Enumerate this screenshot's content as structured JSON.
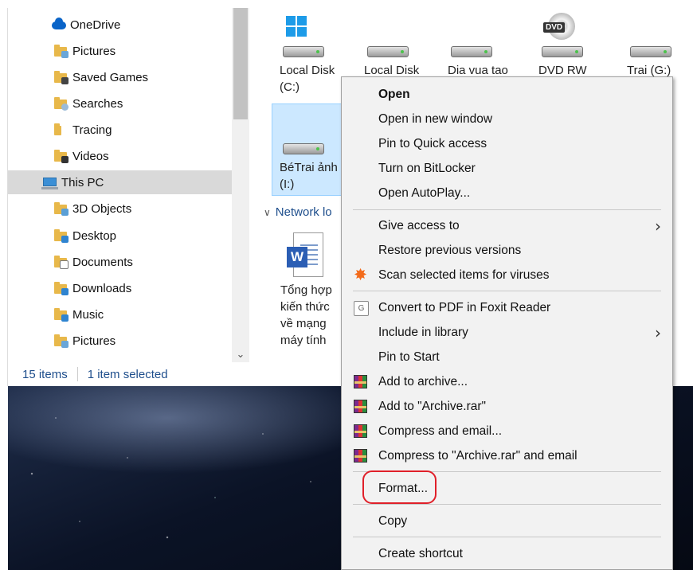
{
  "nav": {
    "items": [
      {
        "label": "OneDrive",
        "icon": "onedrive-icon"
      },
      {
        "label": "Pictures",
        "icon": "pictures-folder-icon"
      },
      {
        "label": "Saved Games",
        "icon": "saved-games-folder-icon"
      },
      {
        "label": "Searches",
        "icon": "searches-folder-icon"
      },
      {
        "label": "Tracing",
        "icon": "folder-icon"
      },
      {
        "label": "Videos",
        "icon": "videos-folder-icon"
      },
      {
        "label": "This PC",
        "icon": "this-pc-icon"
      },
      {
        "label": "3D Objects",
        "icon": "3d-objects-folder-icon"
      },
      {
        "label": "Desktop",
        "icon": "desktop-folder-icon"
      },
      {
        "label": "Documents",
        "icon": "documents-folder-icon"
      },
      {
        "label": "Downloads",
        "icon": "downloads-folder-icon"
      },
      {
        "label": "Music",
        "icon": "music-folder-icon"
      },
      {
        "label": "Pictures",
        "icon": "pictures-folder-icon"
      }
    ],
    "selected": "This PC"
  },
  "drives": [
    {
      "line1": "Local Disk",
      "line2": "(C:)",
      "icon": "system-drive-icon"
    },
    {
      "line1": "Local Disk",
      "line2": "",
      "icon": "hard-drive-icon"
    },
    {
      "line1": "Dia vua tao",
      "line2": "",
      "icon": "hard-drive-icon"
    },
    {
      "line1": "DVD RW",
      "line2": "",
      "icon": "dvd-drive-icon"
    },
    {
      "line1": "Trai (G:)",
      "line2": "",
      "icon": "hard-drive-icon"
    },
    {
      "line1": "BéTrai ảnh",
      "line2": "(I:)",
      "icon": "hard-drive-icon"
    }
  ],
  "dvd_badge": "DVD",
  "network_header": "Network lo",
  "network_file": {
    "lines": [
      "Tổng hợp",
      "kiến thức",
      "về mạng",
      "máy tính"
    ],
    "icon": "word-document-icon",
    "badge": "W"
  },
  "status": {
    "count": "15 items",
    "selection": "1 item selected"
  },
  "context_menu": {
    "items": [
      {
        "label": "Open",
        "bold": true
      },
      {
        "label": "Open in new window"
      },
      {
        "label": "Pin to Quick access"
      },
      {
        "label": "Turn on BitLocker"
      },
      {
        "label": "Open AutoPlay..."
      },
      {
        "label": "Give access to",
        "submenu": true
      },
      {
        "label": "Restore previous versions"
      },
      {
        "label": "Scan selected items for viruses",
        "icon": "avast-icon"
      },
      {
        "label": "Convert to PDF in Foxit Reader",
        "icon": "foxit-icon"
      },
      {
        "label": "Include in library",
        "submenu": true
      },
      {
        "label": "Pin to Start"
      },
      {
        "label": "Add to archive...",
        "icon": "winrar-icon"
      },
      {
        "label": "Add to \"Archive.rar\"",
        "icon": "winrar-icon"
      },
      {
        "label": "Compress and email...",
        "icon": "winrar-icon"
      },
      {
        "label": "Compress to \"Archive.rar\" and email",
        "icon": "winrar-icon"
      },
      {
        "label": "Format..."
      },
      {
        "label": "Copy"
      },
      {
        "label": "Create shortcut"
      }
    ],
    "submenu_arrow": "›"
  },
  "colors": {
    "highlight": "#e0202a",
    "selection": "#cce8ff",
    "accent": "#1e4e8c"
  }
}
